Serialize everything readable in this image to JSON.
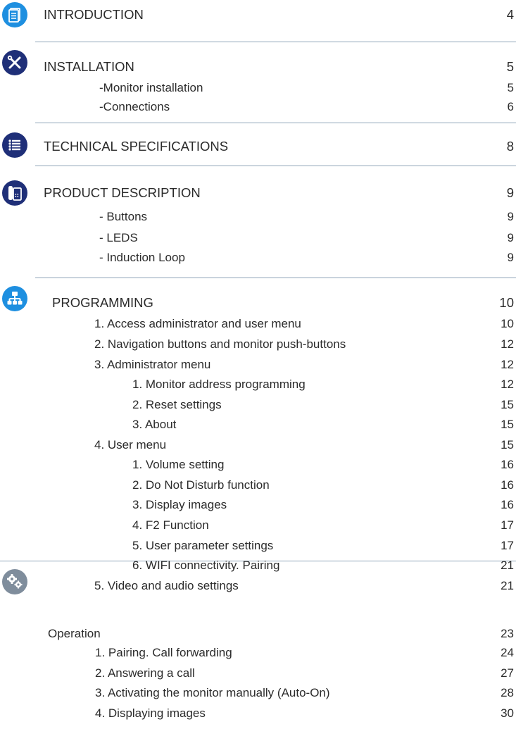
{
  "sections": [
    {
      "title": "INTRODUCTION",
      "page": "4",
      "icon": "document-icon",
      "entries": []
    },
    {
      "title": "INSTALLATION",
      "page": "5",
      "icon": "tools-icon",
      "entries": [
        {
          "label": "-Monitor installation",
          "page": "5"
        },
        {
          "label": "-Connections",
          "page": "6"
        }
      ]
    },
    {
      "title": "TECHNICAL SPECIFICATIONS",
      "page": "8",
      "icon": "list-icon",
      "entries": []
    },
    {
      "title": "PRODUCT DESCRIPTION",
      "page": "9",
      "icon": "monitor-icon",
      "entries": [
        {
          "label": "- Buttons",
          "page": "9"
        },
        {
          "label": "- LEDS",
          "page": "9"
        },
        {
          "label": "- Induction Loop",
          "page": "9"
        }
      ]
    },
    {
      "title": "PROGRAMMING",
      "page": "10",
      "icon": "network-icon",
      "entries": [
        {
          "label": "1. Access administrator and user menu",
          "page": "10"
        },
        {
          "label": "2. Navigation buttons and monitor push-buttons",
          "page": "12"
        },
        {
          "label": "3. Administrator menu",
          "page": "12"
        },
        {
          "label": "1. Monitor address programming",
          "page": "12"
        },
        {
          "label": "2. Reset settings",
          "page": "15"
        },
        {
          "label": "3. About",
          "page": "15"
        },
        {
          "label": "4. User menu",
          "page": "15"
        },
        {
          "label": "1. Volume setting",
          "page": "16"
        },
        {
          "label": "2. Do Not Disturb function",
          "page": "16"
        },
        {
          "label": "3. Display images",
          "page": "16"
        },
        {
          "label": "4. F2 Function",
          "page": "17"
        },
        {
          "label": "5. User parameter settings",
          "page": "17"
        },
        {
          "label": "6. WIFI connectivity. Pairing",
          "page": "21"
        },
        {
          "label": "5. Video and audio settings",
          "page": "21"
        }
      ]
    },
    {
      "title": "Operation",
      "page": "23",
      "icon": "gears-icon",
      "entries": [
        {
          "label": "1. Pairing. Call forwarding",
          "page": "24"
        },
        {
          "label": "2. Answering a call",
          "page": "27"
        },
        {
          "label": "3. Activating the monitor manually (Auto-On)",
          "page": "28"
        },
        {
          "label": "4. Displaying images",
          "page": "30"
        }
      ]
    }
  ],
  "colors": {
    "icon_blue": "#1e8fe0",
    "icon_navy": "#1f2f78",
    "icon_gray": "#7f8d9c",
    "separator": "#8fa4b8",
    "text": "#2b2b2b"
  }
}
